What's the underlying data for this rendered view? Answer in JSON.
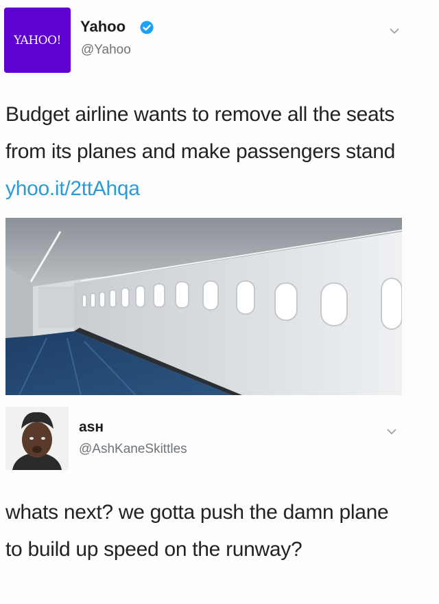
{
  "tweet1": {
    "avatar_text": "YAHOO!",
    "display_name": "Yahoo",
    "handle": "@Yahoo",
    "verified": true,
    "text": "Budget airline wants to remove all the seats from its planes and make passengers stand ",
    "link": "yhoo.it/2ttAhqa",
    "media": "airplane-cabin-without-seats",
    "accent_color": "#5f01d1",
    "link_color": "#2b9ad6"
  },
  "tweet2": {
    "display_name": "aѕн",
    "handle": "@AshKaneSkittles",
    "text": "whats next? we gotta push the damn plane to build up speed on the runway?"
  }
}
